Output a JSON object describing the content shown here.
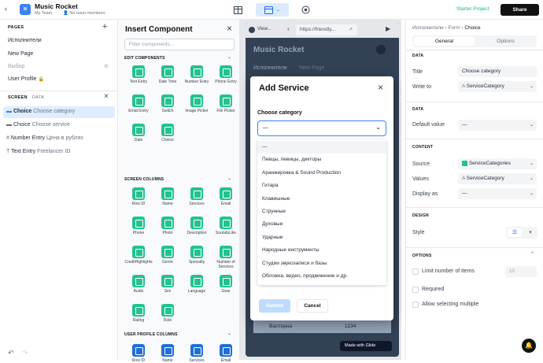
{
  "topbar": {
    "app_name": "Music Rocket",
    "team": "My Team",
    "members": "No team members",
    "starter": "Starter Project",
    "share": "Share",
    "logo": "M"
  },
  "left": {
    "pages_header": "PAGES",
    "pages": [
      "Исполнители",
      "New Page",
      "Выбор",
      "User Profile"
    ],
    "screen_tab": "SCREEN",
    "data_tab": "DATA",
    "components": [
      {
        "type": "Choice",
        "label": "Choose category"
      },
      {
        "type": "Choice",
        "label": "Choose service"
      },
      {
        "type": "Number Entry",
        "label": "Цена в рублях"
      },
      {
        "type": "Text Entry",
        "label": "Freelancer ID"
      }
    ]
  },
  "insert": {
    "title": "Insert Component",
    "filter_placeholder": "Filter components...",
    "edit_header": "EDIT COMPONENTS",
    "edit": [
      "Text Entry",
      "Date Time",
      "Number Entry",
      "Phone Entry",
      "Email Entry",
      "Switch",
      "Image Picker",
      "File Picker",
      "Date",
      "Choice"
    ],
    "screen_header": "SCREEN COLUMNS",
    "screen": [
      "Row ID",
      "Name",
      "Services",
      "Email",
      "Phone",
      "Photo",
      "Description",
      "SoundsLike",
      "CreditHighlights",
      "Genre",
      "Specialty",
      "Number of Services",
      "Audio",
      "Sex",
      "Language",
      "Gear",
      "Rating",
      "Role"
    ],
    "user_header": "USER PROFILE COLUMNS",
    "user": [
      "Row ID",
      "Name",
      "Services",
      "Email"
    ]
  },
  "preview": {
    "view_label": "View...",
    "url": "https://friendly...",
    "app_title": "Music Rocket",
    "tab1": "Исполнители",
    "tab2": "New Page",
    "row_name": "Валторна",
    "row_value": "1234",
    "made_with": "Made with Glide"
  },
  "modal": {
    "title": "Add Service",
    "field_label": "Choose category",
    "selected": "—",
    "submit": "Submit",
    "cancel": "Cancel",
    "options": [
      "—",
      "Певцы, певицы, дикторы",
      "Аранжировка & Sound Production",
      "Гитара",
      "Клавишные",
      "Струнные",
      "Духовые",
      "Ударные",
      "Народные инструменты",
      "Студии звукозаписи и базы",
      "Обложка, видео, продвижение и др."
    ]
  },
  "right": {
    "crumb1": "Исполнители",
    "crumb2": "Form",
    "crumb3": "Choice",
    "tab_general": "General",
    "tab_options": "Options",
    "data_header": "DATA",
    "title_label": "Title",
    "title_value": "Choose category",
    "write_label": "Write to",
    "write_value": "ServiceCategory",
    "data2_header": "DATA",
    "default_label": "Default value",
    "default_value": "—",
    "content_header": "CONTENT",
    "source_label": "Source",
    "source_value": "ServiceCategories",
    "values_label": "Values",
    "values_value": "ServiceCategory",
    "display_label": "Display as",
    "display_value": "—",
    "design_header": "DESIGN",
    "style_label": "Style",
    "options_header": "OPTIONS",
    "limit_label": "Limit number of items",
    "limit_value": "10",
    "required_label": "Required",
    "multiple_label": "Allow selecting multiple"
  },
  "colors": {
    "accent": "#3b82f6",
    "green": "#22c38e",
    "blue": "#1e6fd9",
    "preview_bg": "#334155"
  }
}
